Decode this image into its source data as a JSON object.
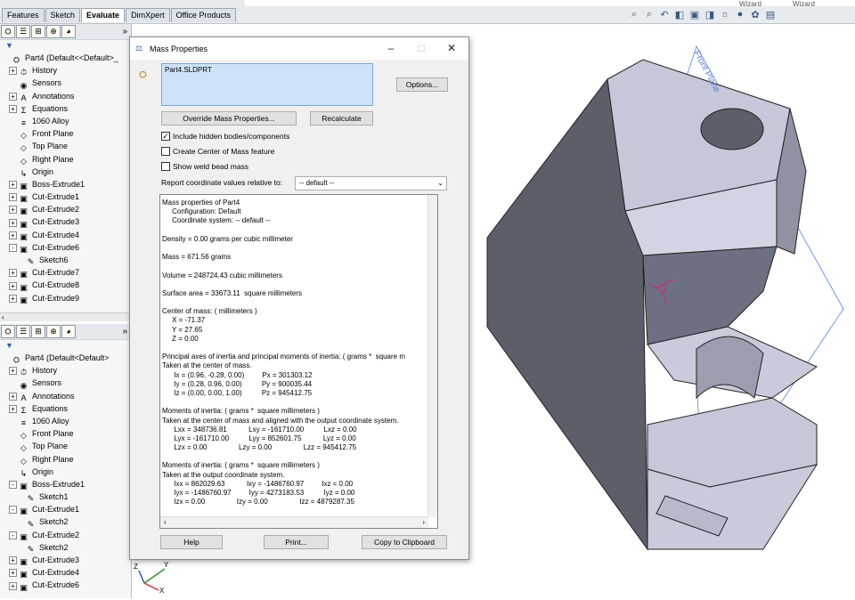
{
  "command_tabs": [
    {
      "label": "Features",
      "active": false
    },
    {
      "label": "Sketch",
      "active": false
    },
    {
      "label": "Evaluate",
      "active": true
    },
    {
      "label": "DimXpert",
      "active": false
    },
    {
      "label": "Office Products",
      "active": false
    }
  ],
  "top_words": [
    "Wizard",
    "Wizard"
  ],
  "tree_toolbar_more": "»",
  "tree1": [
    {
      "indent": 0,
      "exp": "",
      "icon": "part",
      "label": "Part4  (Default<<Default>_"
    },
    {
      "indent": 1,
      "exp": "+",
      "icon": "history",
      "label": "History"
    },
    {
      "indent": 1,
      "exp": "",
      "icon": "sensor",
      "label": "Sensors"
    },
    {
      "indent": 1,
      "exp": "+",
      "icon": "annotation",
      "label": "Annotations"
    },
    {
      "indent": 1,
      "exp": "+",
      "icon": "equation",
      "label": "Equations"
    },
    {
      "indent": 1,
      "exp": "",
      "icon": "material",
      "label": "1060 Alloy"
    },
    {
      "indent": 1,
      "exp": "",
      "icon": "plane",
      "label": "Front Plane"
    },
    {
      "indent": 1,
      "exp": "",
      "icon": "plane",
      "label": "Top Plane"
    },
    {
      "indent": 1,
      "exp": "",
      "icon": "plane",
      "label": "Right Plane"
    },
    {
      "indent": 1,
      "exp": "",
      "icon": "origin",
      "label": "Origin"
    },
    {
      "indent": 1,
      "exp": "+",
      "icon": "feature",
      "label": "Boss-Extrude1"
    },
    {
      "indent": 1,
      "exp": "+",
      "icon": "feature",
      "label": "Cut-Extrude1"
    },
    {
      "indent": 1,
      "exp": "+",
      "icon": "feature",
      "label": "Cut-Extrude2"
    },
    {
      "indent": 1,
      "exp": "+",
      "icon": "feature",
      "label": "Cut-Extrude3"
    },
    {
      "indent": 1,
      "exp": "+",
      "icon": "feature",
      "label": "Cut-Extrude4"
    },
    {
      "indent": 1,
      "exp": "-",
      "icon": "feature",
      "label": "Cut-Extrude6"
    },
    {
      "indent": 2,
      "exp": "",
      "icon": "sketch",
      "label": "Sketch6"
    },
    {
      "indent": 1,
      "exp": "+",
      "icon": "feature",
      "label": "Cut-Extrude7"
    },
    {
      "indent": 1,
      "exp": "+",
      "icon": "feature",
      "label": "Cut-Extrude8"
    },
    {
      "indent": 1,
      "exp": "+",
      "icon": "feature",
      "label": "Cut-Extrude9"
    }
  ],
  "tree2": [
    {
      "indent": 0,
      "exp": "",
      "icon": "part",
      "label": "Part4  (Default<Default>"
    },
    {
      "indent": 1,
      "exp": "+",
      "icon": "history",
      "label": "History"
    },
    {
      "indent": 1,
      "exp": "",
      "icon": "sensor",
      "label": "Sensors"
    },
    {
      "indent": 1,
      "exp": "+",
      "icon": "annotation",
      "label": "Annotations"
    },
    {
      "indent": 1,
      "exp": "+",
      "icon": "equation",
      "label": "Equations"
    },
    {
      "indent": 1,
      "exp": "",
      "icon": "material",
      "label": "1060 Alloy"
    },
    {
      "indent": 1,
      "exp": "",
      "icon": "plane",
      "label": "Front Plane"
    },
    {
      "indent": 1,
      "exp": "",
      "icon": "plane",
      "label": "Top Plane"
    },
    {
      "indent": 1,
      "exp": "",
      "icon": "plane",
      "label": "Right Plane"
    },
    {
      "indent": 1,
      "exp": "",
      "icon": "origin",
      "label": "Origin"
    },
    {
      "indent": 1,
      "exp": "-",
      "icon": "feature",
      "label": "Boss-Extrude1"
    },
    {
      "indent": 2,
      "exp": "",
      "icon": "sketch",
      "label": "Sketch1"
    },
    {
      "indent": 1,
      "exp": "-",
      "icon": "feature",
      "label": "Cut-Extrude1"
    },
    {
      "indent": 2,
      "exp": "",
      "icon": "sketch",
      "label": "Sketch2"
    },
    {
      "indent": 1,
      "exp": "-",
      "icon": "feature",
      "label": "Cut-Extrude2"
    },
    {
      "indent": 2,
      "exp": "",
      "icon": "sketch",
      "label": "Sketch2"
    },
    {
      "indent": 1,
      "exp": "+",
      "icon": "feature",
      "label": "Cut-Extrude3"
    },
    {
      "indent": 1,
      "exp": "+",
      "icon": "feature",
      "label": "Cut-Extrude4"
    },
    {
      "indent": 1,
      "exp": "+",
      "icon": "feature",
      "label": "Cut-Extrude6"
    }
  ],
  "dialog": {
    "title": "Mass Properties",
    "selected_item": "Part4.SLDPRT",
    "options_label": "Options...",
    "override_label": "Override Mass Properties...",
    "recalculate_label": "Recalculate",
    "include_hidden": {
      "label": "Include hidden bodies/components",
      "checked": true
    },
    "create_com": {
      "label": "Create Center of Mass feature",
      "checked": false
    },
    "show_weld": {
      "label": "Show weld bead mass",
      "checked": false
    },
    "report_label": "Report coordinate values relative to:",
    "coord_value": "-- default --",
    "results": [
      "Mass properties of Part4",
      "     Configuration: Default",
      "     Coordinate system: -- default --",
      "",
      "Density = 0.00 grams per cubic millimeter",
      "",
      "Mass = 671.56 grams",
      "",
      "Volume = 248724.43 cubic millimeters",
      "",
      "Surface area = 33673.11  square millimeters",
      "",
      "Center of mass: ( millimeters )",
      "     X = -71.37",
      "     Y = 27.65",
      "     Z = 0.00",
      "",
      "Principal axes of inertia and principal moments of inertia: ( grams *  square m",
      "Taken at the center of mass.",
      "      Ix = (0.96, -0.28, 0.00)         Px = 301303.12",
      "      Iy = (0.28, 0.96, 0.00)          Py = 900035.44",
      "      Iz = (0.00, 0.00, 1.00)          Pz = 945412.75",
      "",
      "Moments of inertia: ( grams *  square millimeters )",
      "Taken at the center of mass and aligned with the output coordinate system.",
      "      Lxx = 348736.81           Lxy = -161710.00          Lxz = 0.00",
      "      Lyx = -161710.00          Lyy = 852601.75           Lyz = 0.00",
      "      Lzx = 0.00                Lzy = 0.00                Lzz = 945412.75",
      "",
      "Moments of inertia: ( grams *  square millimeters )",
      "Taken at the output coordinate system.",
      "      Ixx = 862029.63           Ixy = -1486760.97         Ixz = 0.00",
      "      Iyx = -1486760.97         Iyy = 4273183.53          Iyz = 0.00",
      "      Izx = 0.00                Izy = 0.00                Izz = 4879287.35"
    ],
    "help_label": "Help",
    "print_label": "Print...",
    "copy_label": "Copy to Clipboard"
  },
  "viewport": {
    "plane_label": "Front Plane"
  },
  "triad": {
    "x": "X",
    "y": "Y",
    "z": "Z"
  },
  "icons": {
    "part": "⛭",
    "history": "⏱",
    "sensor": "◉",
    "annotation": "A",
    "equation": "Σ",
    "material": "≡",
    "plane": "◇",
    "origin": "↳",
    "feature": "▣",
    "sketch": "✎"
  },
  "colors": {
    "accent": "#2b5aa3",
    "selection": "#cde3f7",
    "part_face": "#c9cbdb",
    "part_dark": "#5c5f69",
    "plane": "#5a7fe0"
  }
}
